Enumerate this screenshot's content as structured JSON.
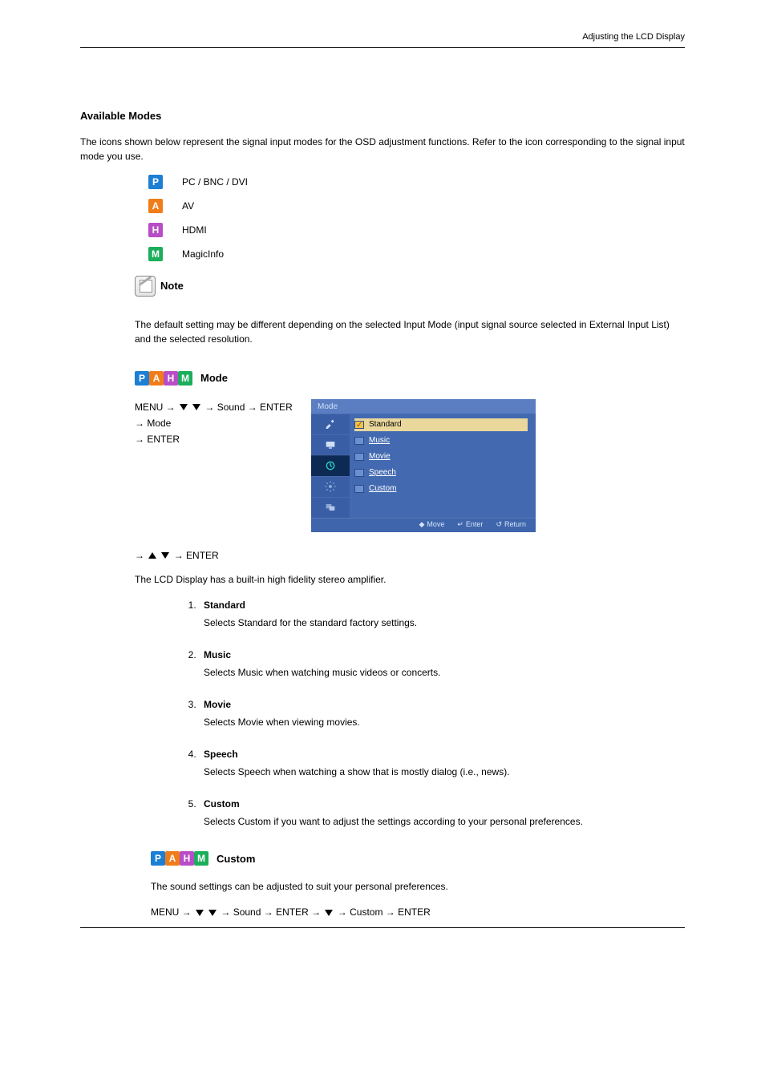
{
  "section1": {
    "title": "Available Modes",
    "intro": "The icons shown below represent the signal input modes for the OSD adjustment functions. Refer to the icon corresponding to the signal input mode you use.",
    "items": [
      {
        "chip": "P",
        "chipClass": "p",
        "label": "PC / BNC / DVI"
      },
      {
        "chip": "A",
        "chipClass": "a",
        "label": "AV"
      },
      {
        "chip": "H",
        "chipClass": "h",
        "label": "HDMI"
      },
      {
        "chip": "M",
        "chipClass": "m",
        "label": "MagicInfo"
      }
    ],
    "noteLabel": "Note",
    "note": "The default setting may be different depending on the selected Input Mode (input signal source selected in External Input List) and the selected resolution."
  },
  "mode": {
    "heading": "Mode",
    "ctxLine1Prefix": "MENU →",
    "ctxLine1Suffix": "→ Sound → ENTER → Mode",
    "ctxLine2": "→ ENTER",
    "steps_intro": "The LCD Display has a built-in high fidelity stereo amplifier.",
    "step_arrows_text": "→ ENTER",
    "options": [
      {
        "name": "Standard",
        "desc": "Selects Standard for the standard factory settings."
      },
      {
        "name": "Music",
        "desc": "Selects Music when watching music videos or concerts."
      },
      {
        "name": "Movie",
        "desc": "Selects Movie when viewing movies."
      },
      {
        "name": "Speech",
        "desc": "Selects Speech when watching a show that is mostly dialog (i.e., news)."
      },
      {
        "name": "Custom",
        "desc": "Selects Custom if you want to adjust the settings according to your personal preferences."
      }
    ]
  },
  "osd": {
    "header": "Mode",
    "rows": [
      "Standard",
      "Music",
      "Movie",
      "Speech",
      "Custom"
    ],
    "footer": {
      "move": "Move",
      "enter": "Enter",
      "return": "Return"
    }
  },
  "custom": {
    "heading": "Custom",
    "intro": "The sound settings can be adjusted to suit your personal preferences.",
    "pathPrefix": "MENU →",
    "pathMid": "→ Sound → ENTER →",
    "pathSuffix": "→ Custom → ENTER"
  },
  "page": {
    "header_right": "Adjusting the LCD Display"
  }
}
